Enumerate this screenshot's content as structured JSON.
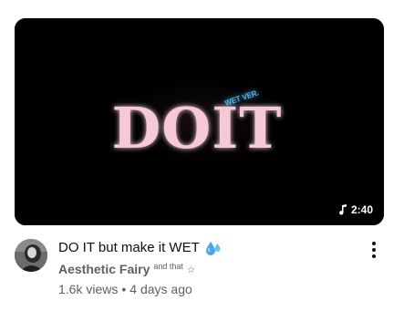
{
  "video": {
    "thumbnail": {
      "logo_text": "DOIT",
      "badge_text": "WET VER.",
      "background_color": "#000000",
      "logo_color": "#f6c9d8",
      "badge_color": "#5ab4ef"
    },
    "duration": "2:40",
    "duration_icon": "music-note-icon",
    "title": "DO IT but make it WET",
    "title_emoji_icon": "sweat-droplets-icon",
    "channel": {
      "name": "Aesthetic Fairy",
      "suffix": "and that",
      "suffix_icon": "star-outline-icon"
    },
    "views": "1.6k views",
    "separator": "•",
    "published": "4 days ago",
    "menu_icon": "vertical-ellipsis-icon"
  }
}
